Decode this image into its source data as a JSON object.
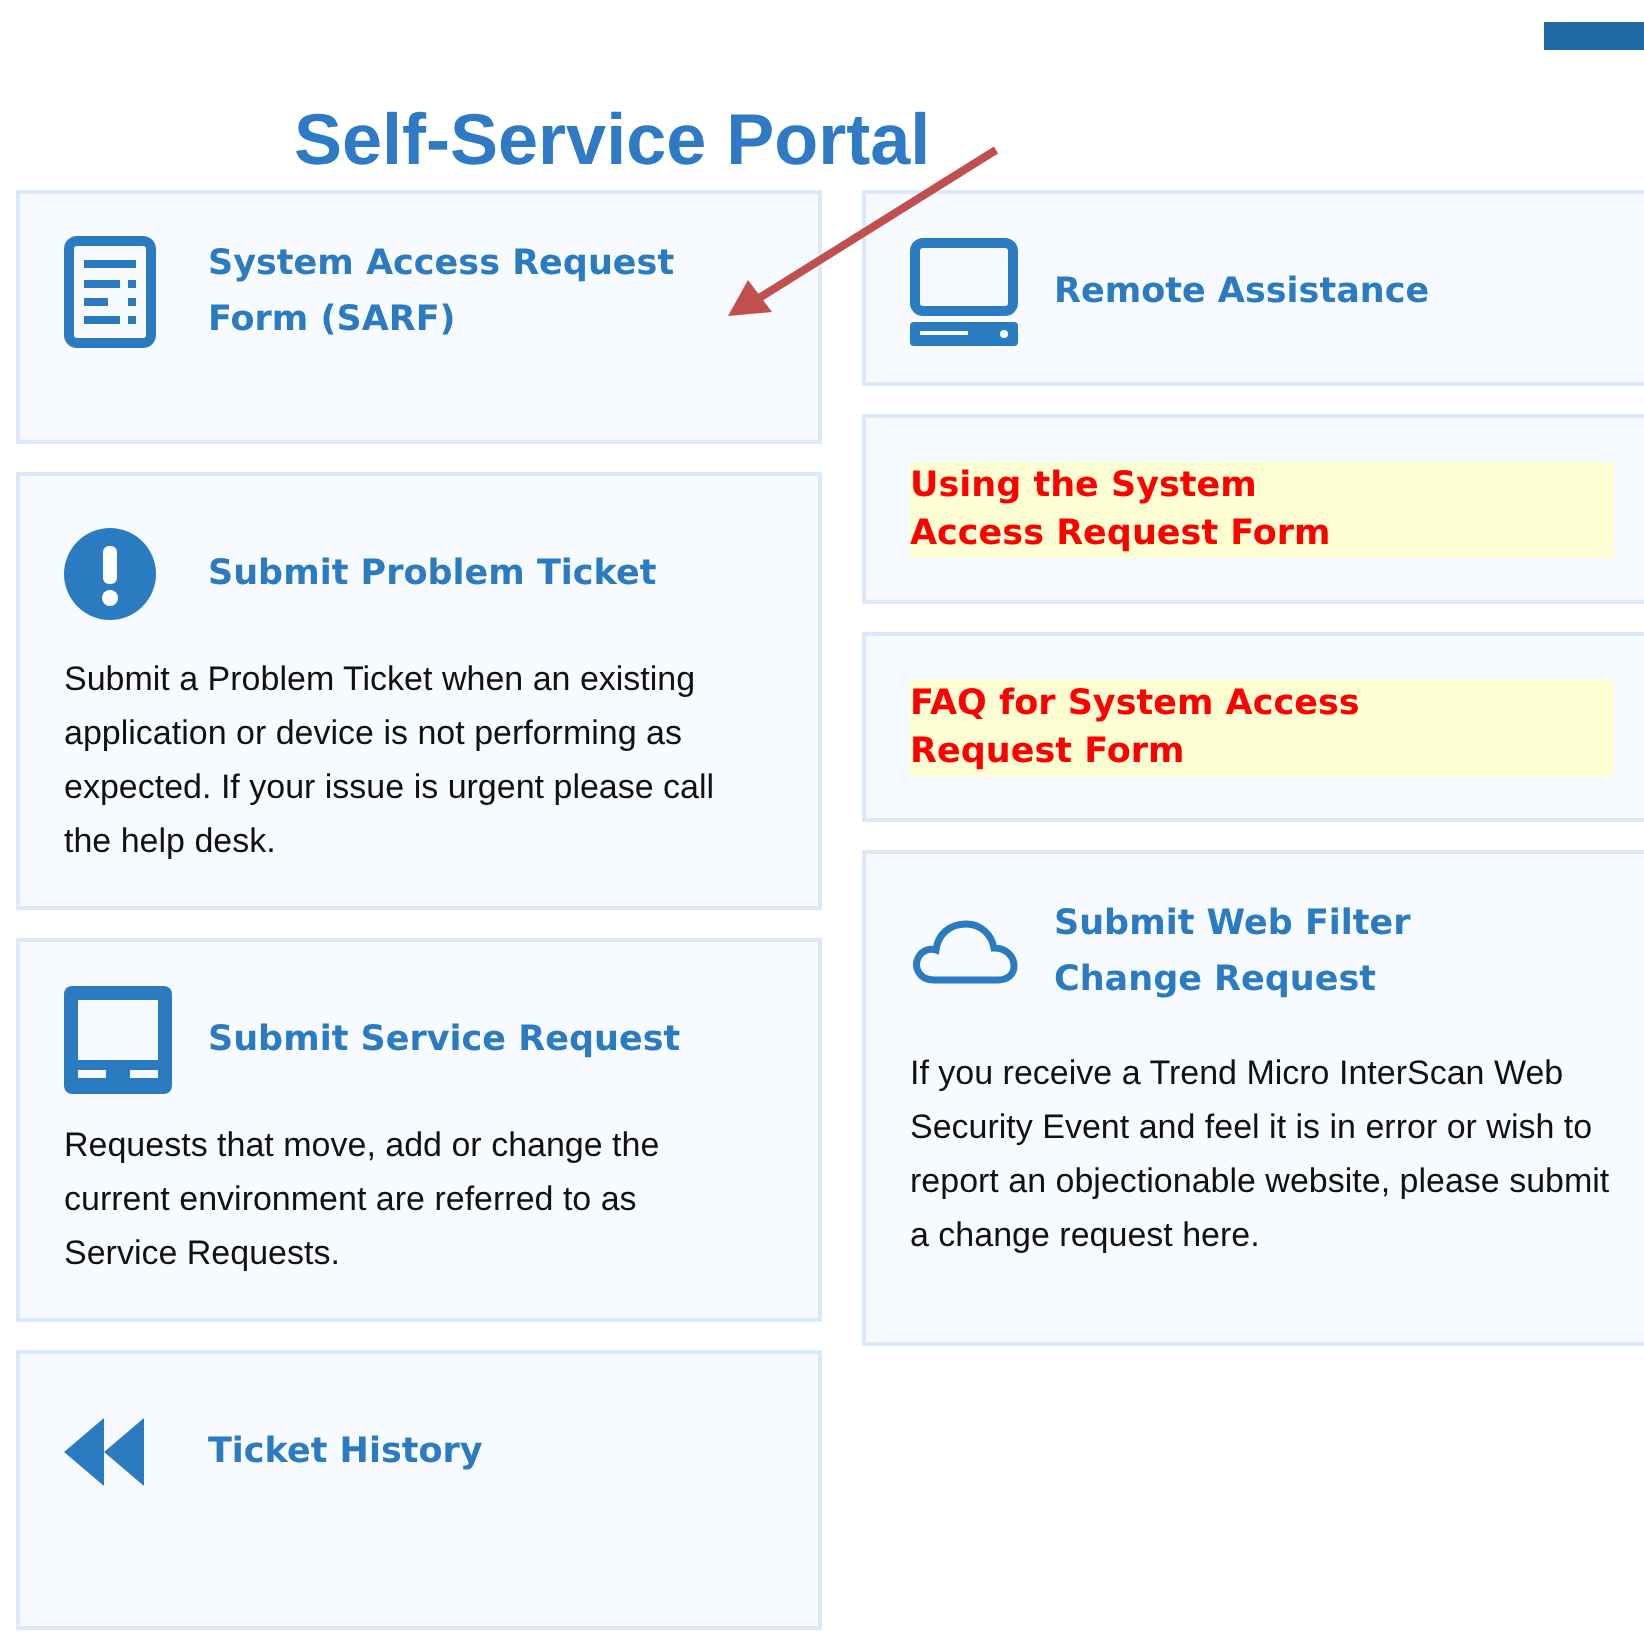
{
  "title": "Self-Service Portal",
  "left_tiles": [
    {
      "kind": "link",
      "heading": "System Access Request Form (SARF)"
    },
    {
      "kind": "link",
      "heading": "Submit Problem Ticket",
      "description": "Submit a Problem Ticket when an existing application or device is not performing as expected. If your issue is urgent please call the help desk."
    },
    {
      "kind": "link",
      "heading": "Submit Service Request",
      "description": "Requests that move, add or change the current environment are referred to as Service Requests."
    },
    {
      "kind": "link",
      "heading": "Ticket History"
    }
  ],
  "right_tiles": [
    {
      "kind": "link",
      "heading": "Remote Assistance"
    },
    {
      "kind": "highlight",
      "heading": "Using the System\nAccess Request Form"
    },
    {
      "kind": "highlight",
      "heading": "FAQ for System Access\nRequest Form"
    },
    {
      "kind": "link",
      "heading": "Submit Web Filter\nChange Request",
      "description": "If you receive a Trend Micro InterScan Web Security Event and feel it is in error or wish to report an objectionable website, please submit a change request here."
    }
  ]
}
